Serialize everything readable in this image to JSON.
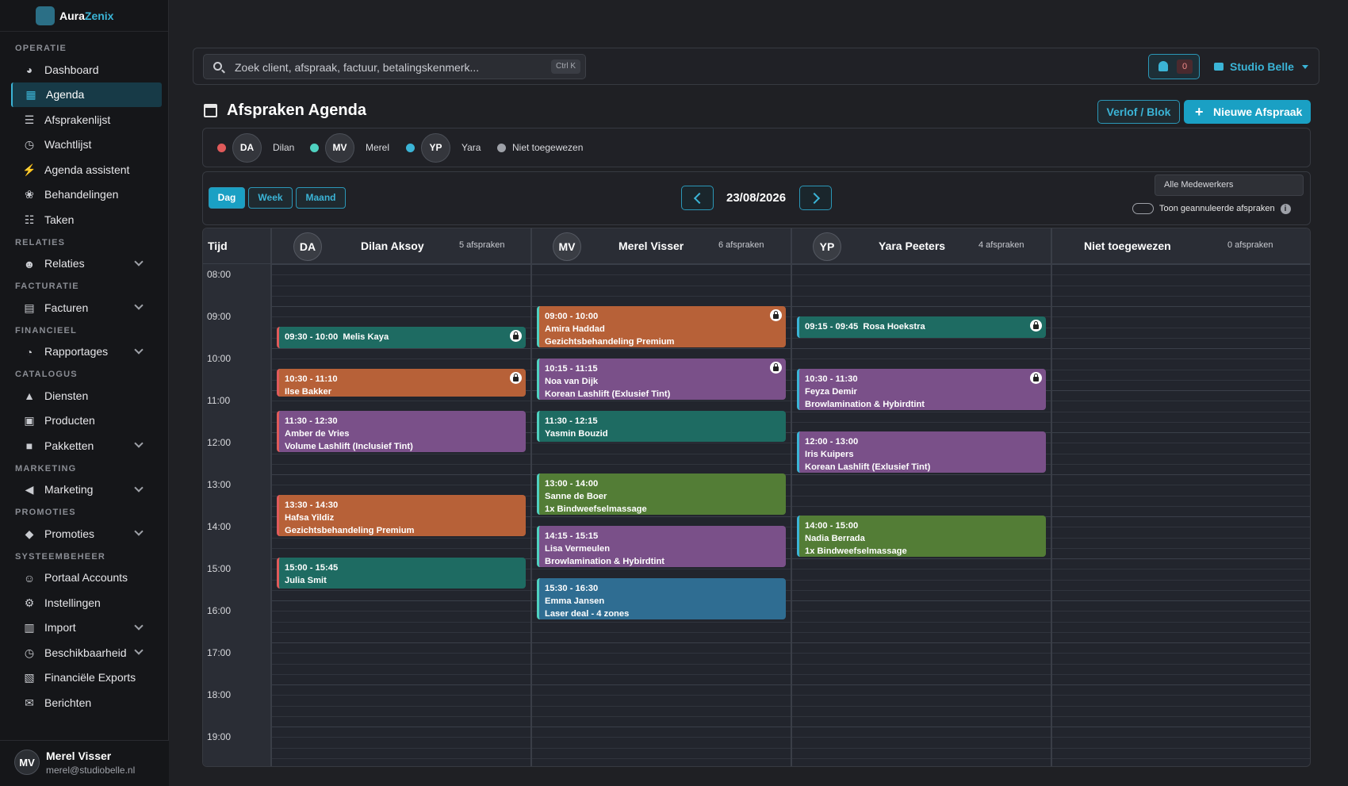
{
  "brand": {
    "name_a": "Aura",
    "name_b": "Zenix"
  },
  "nav": {
    "sections": {
      "operatie": "OPERATIE",
      "relaties": "RELATIES",
      "facturatie": "FACTURATIE",
      "financieel": "FINANCIEEL",
      "catalogus": "CATALOGUS",
      "marketing": "MARKETING",
      "promoties": "PROMOTIES",
      "systeembeheer": "SYSTEEMBEHEER"
    },
    "items": {
      "dashboard": "Dashboard",
      "agenda": "Agenda",
      "afsprakenlijst": "Afsprakenlijst",
      "wachtlijst": "Wachtlijst",
      "agenda_assistent": "Agenda assistent",
      "behandelingen": "Behandelingen",
      "taken": "Taken",
      "relaties": "Relaties",
      "facturen": "Facturen",
      "rapportages": "Rapportages",
      "diensten": "Diensten",
      "producten": "Producten",
      "pakketten": "Pakketten",
      "marketing": "Marketing",
      "promoties": "Promoties",
      "portaal_accounts": "Portaal Accounts",
      "instellingen": "Instellingen",
      "import": "Import",
      "beschikbaarheid": "Beschikbaarheid",
      "financiele_exports": "Financiële Exports",
      "berichten": "Berichten"
    }
  },
  "user": {
    "initials": "MV",
    "name": "Merel Visser",
    "email": "merel@studiobelle.nl"
  },
  "topbar": {
    "search_placeholder": "Zoek client, afspraak, factuur, betalingskenmerk...",
    "search_shortcut": "Ctrl K",
    "notification_count": "0",
    "studio": "Studio Belle"
  },
  "page": {
    "title": "Afspraken Agenda",
    "verlof_button": "Verlof / Blok",
    "new_button": "Nieuwe Afspraak"
  },
  "legend": [
    {
      "initials": "DA",
      "name": "Dilan",
      "color": "#e05a5a"
    },
    {
      "initials": "MV",
      "name": "Merel",
      "color": "#4fd1c0"
    },
    {
      "initials": "YP",
      "name": "Yara",
      "color": "#3bb4d6"
    },
    {
      "name": "Niet toegewezen",
      "color": "#9ea1a8"
    }
  ],
  "toolbar": {
    "views": [
      "Dag",
      "Week",
      "Maand"
    ],
    "active_view": "Dag",
    "date": "23/08/2026",
    "staff_filter": "Alle Medewerkers",
    "toggle_label": "Toon geannuleerde afspraken",
    "toggle_on": false
  },
  "calendar": {
    "time_header": "Tijd",
    "hours": [
      "08:00",
      "09:00",
      "10:00",
      "11:00",
      "12:00",
      "13:00",
      "14:00",
      "15:00",
      "16:00",
      "17:00",
      "18:00",
      "19:00"
    ],
    "columns": [
      {
        "initials": "DA",
        "name": "Dilan Aksoy",
        "count": "5 afspraken"
      },
      {
        "initials": "MV",
        "name": "Merel Visser",
        "count": "6 afspraken"
      },
      {
        "initials": "YP",
        "name": "Yara Peeters",
        "count": "4 afspraken"
      },
      {
        "initials": "",
        "name": "Niet toegewezen",
        "count": "0 afspraken"
      }
    ],
    "appointments": {
      "da1": {
        "time": "09:30 - 10:00",
        "client": "Melis Kaya",
        "service": ""
      },
      "da2": {
        "time": "10:30 - 11:10",
        "client": "Ilse Bakker",
        "service": ""
      },
      "da3": {
        "time": "11:30 - 12:30",
        "client": "Amber de Vries",
        "service": "Volume Lashlift (Inclusief Tint)"
      },
      "da4": {
        "time": "13:30 - 14:30",
        "client": "Hafsa Yildiz",
        "service": "Gezichtsbehandeling Premium"
      },
      "da5": {
        "time": "15:00 - 15:45",
        "client": "Julia Smit",
        "service": ""
      },
      "mv1": {
        "time": "09:00 - 10:00",
        "client": "Amira Haddad",
        "service": "Gezichtsbehandeling Premium"
      },
      "mv2": {
        "time": "10:15 - 11:15",
        "client": "Noa van Dijk",
        "service": "Korean Lashlift (Exlusief Tint)"
      },
      "mv3": {
        "time": "11:30 - 12:15",
        "client": "Yasmin Bouzid",
        "service": ""
      },
      "mv4": {
        "time": "13:00 - 14:00",
        "client": "Sanne de Boer",
        "service": "1x Bindweefselmassage"
      },
      "mv5": {
        "time": "14:15 - 15:15",
        "client": "Lisa Vermeulen",
        "service": "Browlamination & Hybirdtint"
      },
      "mv6": {
        "time": "15:30 - 16:30",
        "client": "Emma Jansen",
        "service": "Laser deal - 4 zones"
      },
      "yp1": {
        "time": "09:15 - 09:45",
        "client": "Rosa Hoekstra",
        "service": ""
      },
      "yp2": {
        "time": "10:30 - 11:30",
        "client": "Feyza Demir",
        "service": "Browlamination & Hybirdtint"
      },
      "yp3": {
        "time": "12:00 - 13:00",
        "client": "Iris Kuipers",
        "service": "Korean Lashlift (Exlusief Tint)"
      },
      "yp4": {
        "time": "14:00 - 15:00",
        "client": "Nadia Berrada",
        "service": "1x Bindweefselmassage"
      }
    }
  }
}
